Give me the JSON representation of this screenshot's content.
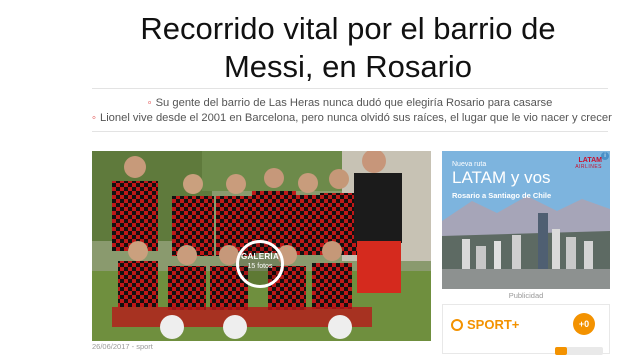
{
  "article": {
    "headline_line1": "Recorrido vital por el barrio de",
    "headline_line2": "Messi, en Rosario",
    "bullets": [
      "Su gente del barrio de Las Heras nunca dudó que elegiría Rosario para casarse",
      "Lionel vive desde el 2001 en Barcelona, pero nunca olvidó sus raíces, el lugar que le vio nacer y crecer"
    ],
    "bullet_glyph": "◦",
    "byline": "26/06/2017 - sport"
  },
  "gallery": {
    "label": "GALERÍA",
    "count": "15 fotos"
  },
  "ad": {
    "small_text": "Nueva ruta",
    "title": "LATAM y vos",
    "subtitle": "Rosario a Santiago de Chile",
    "brand": "LATAM",
    "brand_sub": "AIRLINES",
    "label": "Publicidad",
    "info_icon": "i"
  },
  "sport_widget": {
    "logo_text": "SPORT+",
    "badge": "+0"
  }
}
